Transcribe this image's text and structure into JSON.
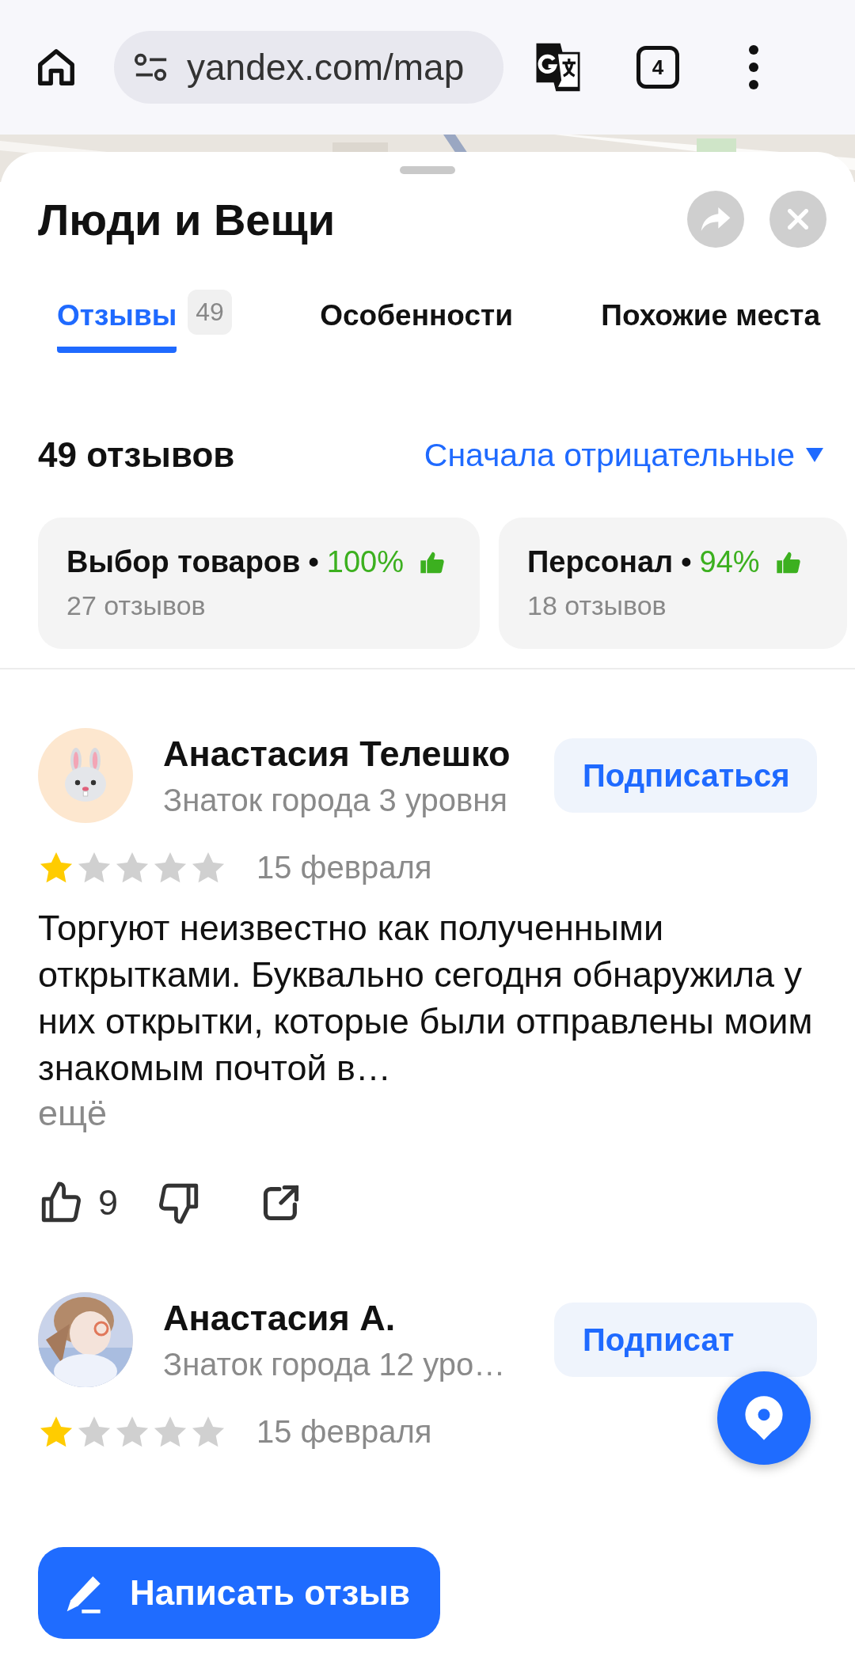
{
  "browser": {
    "url": "yandex.com/map",
    "tab_count": "4"
  },
  "place": {
    "title": "Люди и Вещи"
  },
  "tabs": [
    {
      "label": "Отзывы",
      "badge": "49",
      "selected": true
    },
    {
      "label": "Особенности",
      "selected": false
    },
    {
      "label": "Похожие места",
      "selected": false
    }
  ],
  "reviews_summary": {
    "count": "49 отзывов",
    "sort": "Сначала отрицательные"
  },
  "aspects": [
    {
      "name": "Выбор товаров",
      "separator": "•",
      "percent": "100%",
      "reviews": "27 отзывов"
    },
    {
      "name": "Персонал",
      "separator": "•",
      "percent": "94%",
      "reviews": "18 отзывов"
    }
  ],
  "reviews": [
    {
      "author": "Анастасия Телешко",
      "avatar": {
        "kind": "icon"
      },
      "level": "Знаток города 3 уровня",
      "subscribe": "Подписаться",
      "stars": 1,
      "date": "15 февраля",
      "text": "Торгуют неизвестно как полученными открытками. Буквально сегодня обнаружила у них открытки, которые были отправлены моим знакомым почтой в…",
      "more": "ещё",
      "likes": "9"
    },
    {
      "author": "Анастасия А.",
      "level": "Знаток города 12 уро…",
      "subscribe": "Подписат",
      "stars": 1,
      "date": "15 февраля"
    }
  ],
  "write_review": {
    "label": "Написать отзыв"
  }
}
